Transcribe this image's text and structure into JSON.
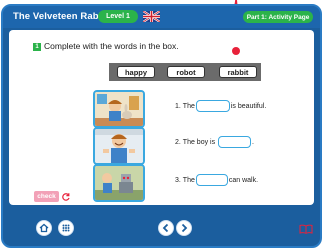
{
  "app": {
    "title": "The Velveteen Rabbit",
    "level": "Level 1",
    "part": "Part 1: Activity Page"
  },
  "exercise": {
    "number": "1",
    "instruction": "Complete with the words in the box."
  },
  "word_box": {
    "words": [
      "happy",
      "robot",
      "rabbit"
    ]
  },
  "sentences": [
    {
      "number": "1.",
      "before": "The",
      "after": "is beautiful."
    },
    {
      "number": "2.",
      "before": "The boy is",
      "after": "."
    },
    {
      "number": "3.",
      "before": "The",
      "after": "can walk."
    }
  ],
  "controls": {
    "check_label": "check"
  },
  "icons": [
    "uk-flag-icon",
    "reset-icon",
    "home-icon",
    "apps-icon",
    "prev-arrow-icon",
    "next-arrow-icon",
    "book-icon"
  ],
  "colors": {
    "frame": "#1b5e9e",
    "badge_green": "#2bb34a",
    "blank_border": "#3aa8e0",
    "accent_red": "#e8213a",
    "check_pink": "#f2a1b7"
  }
}
